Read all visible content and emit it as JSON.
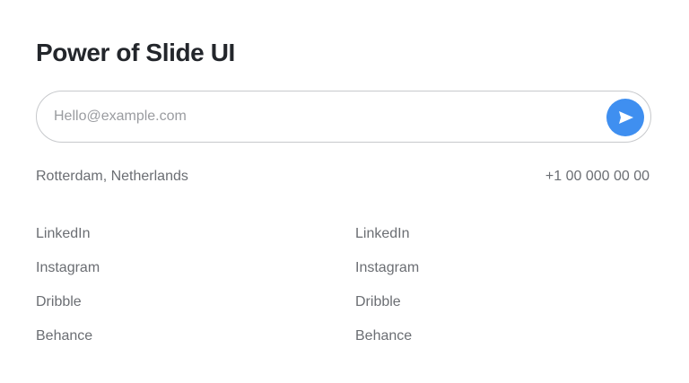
{
  "header": {
    "title": "Power of Slide UI"
  },
  "subscribe": {
    "placeholder": "Hello@example.com",
    "value": "",
    "send_icon": "send-icon",
    "accent_color": "#3f8ff0"
  },
  "contact": {
    "location": "Rotterdam, Netherlands",
    "phone": "+1 00 000 00 00"
  },
  "links_left": [
    {
      "label": "LinkedIn"
    },
    {
      "label": "Instagram"
    },
    {
      "label": "Dribble"
    },
    {
      "label": "Behance"
    }
  ],
  "links_right": [
    {
      "label": "LinkedIn"
    },
    {
      "label": "Instagram"
    },
    {
      "label": "Dribble"
    },
    {
      "label": "Behance"
    }
  ]
}
